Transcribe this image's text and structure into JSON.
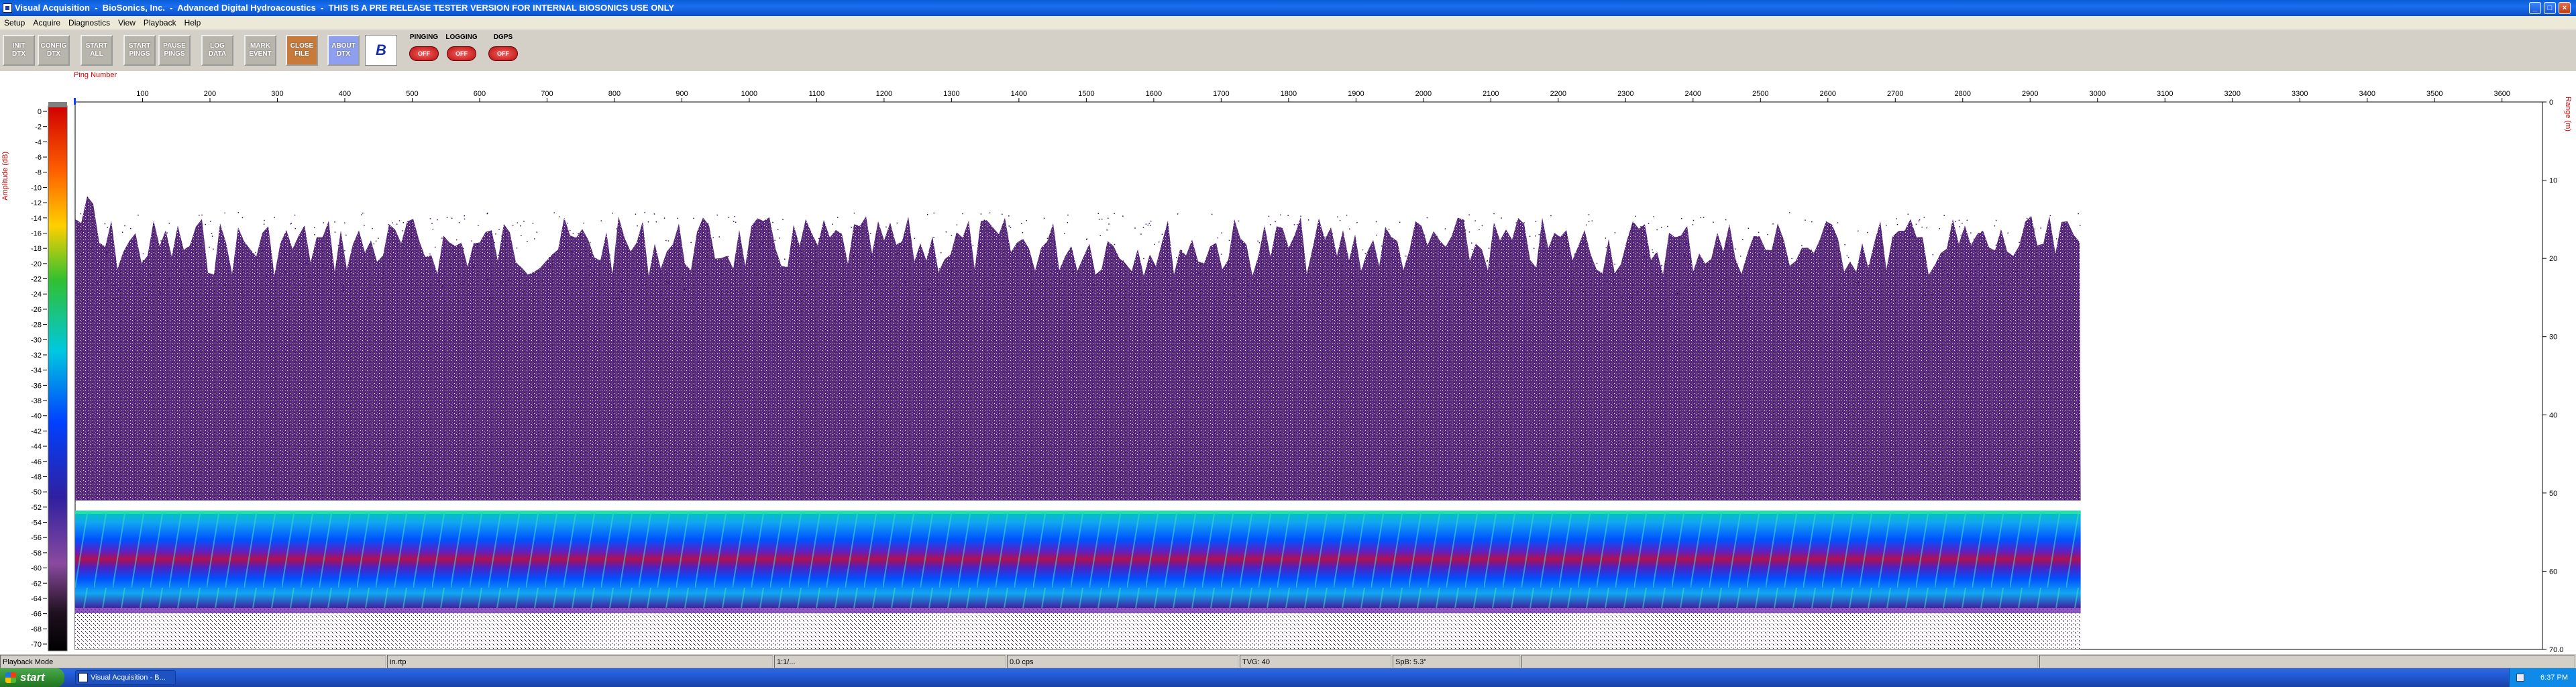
{
  "window": {
    "title": "Visual Acquisition  -  BioSonics, Inc.  -  Advanced Digital Hydroacoustics  -  THIS IS A PRE RELEASE TESTER VERSION FOR INTERNAL BIOSONICS USE ONLY",
    "min": "_",
    "max": "□",
    "close": "×"
  },
  "menu": [
    "Setup",
    "Acquire",
    "Diagnostics",
    "View",
    "Playback",
    "Help"
  ],
  "toolbar": {
    "buttons": [
      {
        "label": "INIT\nDTX",
        "name": "init-dtx-button"
      },
      {
        "label": "CONFIG\nDTX",
        "name": "config-dtx-button"
      },
      {
        "label": "START\nALL",
        "name": "start-all-button"
      },
      {
        "label": "START\nPINGS",
        "name": "start-pings-button"
      },
      {
        "label": "PAUSE\nPINGS",
        "name": "pause-pings-button"
      },
      {
        "label": "LOG\nDATA",
        "name": "log-data-button"
      },
      {
        "label": "MARK\nEVENT",
        "name": "mark-event-button"
      },
      {
        "label": "CLOSE\nFILE",
        "name": "close-file-button"
      },
      {
        "label": "ABOUT\nDTX",
        "name": "about-dtx-button"
      }
    ],
    "logo": "B",
    "indicators": [
      {
        "label": "PINGING",
        "state": "OFF"
      },
      {
        "label": "LOGGING",
        "state": "OFF"
      },
      {
        "label": "DGPS",
        "state": "OFF"
      }
    ]
  },
  "plot": {
    "x_axis_label": "Ping Number",
    "left_axis_label": "Amplitude (dB)",
    "right_axis_label": "Range (m)",
    "x_ticks": [
      "100",
      "200",
      "300",
      "400",
      "500",
      "600",
      "700",
      "800",
      "900",
      "1000",
      "1100",
      "1200",
      "1300",
      "1400",
      "1500",
      "1600",
      "1700",
      "1800",
      "1900",
      "2000",
      "2100",
      "2200",
      "2300",
      "2400",
      "2500",
      "2600",
      "2700",
      "2800",
      "2900",
      "3000",
      "3100",
      "3200",
      "3300",
      "3400",
      "3500",
      "3600"
    ],
    "amplitude_ticks": [
      "0",
      "-2",
      "-4",
      "-6",
      "-8",
      "-10",
      "-12",
      "-14",
      "-16",
      "-18",
      "-20",
      "-22",
      "-24",
      "-26",
      "-28",
      "-30",
      "-32",
      "-34",
      "-36",
      "-38",
      "-40",
      "-42",
      "-44",
      "-46",
      "-48",
      "-50",
      "-52",
      "-54",
      "-56",
      "-58",
      "-60",
      "-62",
      "-64",
      "-66",
      "-68",
      "-70"
    ],
    "range_ticks": [
      "0",
      "10",
      "20",
      "30",
      "40",
      "50",
      "60",
      "70.0"
    ],
    "x_range": [
      0,
      3660
    ],
    "last_ping": 2975,
    "colors": {
      "background": "#ffffff",
      "noise": "#4a1a6e",
      "band_core": "#0050ff",
      "band_edge": "#00c8c0",
      "band_hot": "#c00040"
    }
  },
  "statusbar": {
    "mode": "Playback Mode",
    "panels": [
      "in.rtp",
      "1:1/...",
      "0.0 cps",
      "TVG: 40",
      "SpB: 5.3\""
    ]
  },
  "taskbar": {
    "start": "start",
    "task": "Visual Acquisition - B...",
    "clock": "6:37 PM"
  }
}
